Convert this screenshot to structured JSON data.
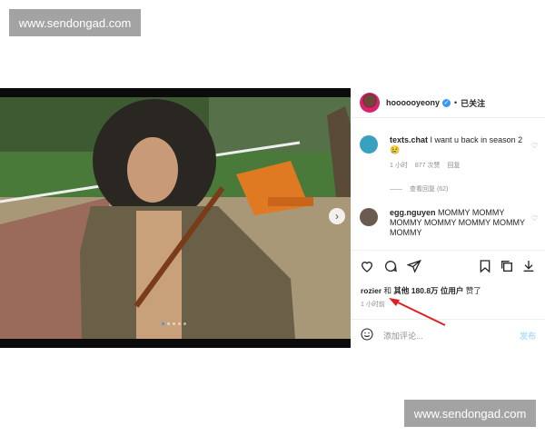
{
  "watermark": {
    "top": "www.sendongad.com",
    "bottom": "www.sendongad.com"
  },
  "post": {
    "header": {
      "username": "hoooooyeony",
      "separator": "•",
      "follow_status": "已关注"
    },
    "comments": [
      {
        "username": "texts.chat",
        "text": "I want u back in season 2",
        "time": "1 小时",
        "likes": "877 次赞",
        "reply": "回复"
      },
      {
        "username": "egg.nguyen",
        "text": "MOMMY MOMMY MOMMY MOMMY MOMMY MOMMY MOMMY"
      }
    ],
    "view_replies": "查看回复 (62)",
    "likes": {
      "user": "rozier",
      "middle": "和",
      "others": "其他 180.8万 位用户",
      "suffix": "赞了"
    },
    "time": "1 小时前",
    "add_comment": {
      "placeholder": "添加评论...",
      "send": "发布"
    },
    "colors": {
      "accent": "#3897f0",
      "arrow": "#e02020"
    },
    "icons": [
      "heart-icon",
      "comment-icon",
      "share-icon",
      "bookmark-icon",
      "copy-icon",
      "download-icon",
      "emoji-icon",
      "chevron-right-icon",
      "verified-icon"
    ]
  }
}
